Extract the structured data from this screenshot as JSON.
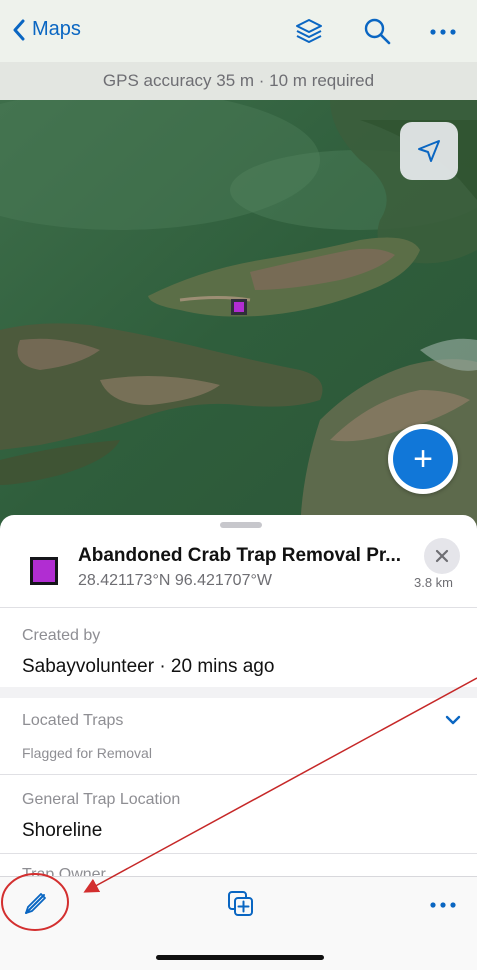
{
  "header": {
    "back_label": "Maps"
  },
  "gps": {
    "text": "GPS accuracy 35 m · 10 m required"
  },
  "feature": {
    "title": "Abandoned Crab Trap Removal Pr...",
    "coords": "28.421173°N 96.421707°W",
    "distance": "3.8 km",
    "marker_color": "#b12dd2"
  },
  "fields": {
    "created_label": "Created by",
    "created_value": "Sabayvolunteer · 20 mins ago",
    "located_label": "Located Traps",
    "located_sub": "Flagged for Removal",
    "location_label": "General Trap Location",
    "location_value": "Shoreline",
    "owner_label": "Trap Owner"
  },
  "colors": {
    "accent": "#0a66c2",
    "annotation": "#c62828"
  },
  "icons": {
    "back": "chevron-left-icon",
    "layers": "layers-icon",
    "search": "search-icon",
    "more": "more-icon",
    "locate": "location-arrow-icon",
    "add": "plus-icon",
    "close": "close-icon",
    "expand": "chevron-down-icon",
    "edit": "pencil-icon",
    "duplicate": "duplicate-icon"
  }
}
